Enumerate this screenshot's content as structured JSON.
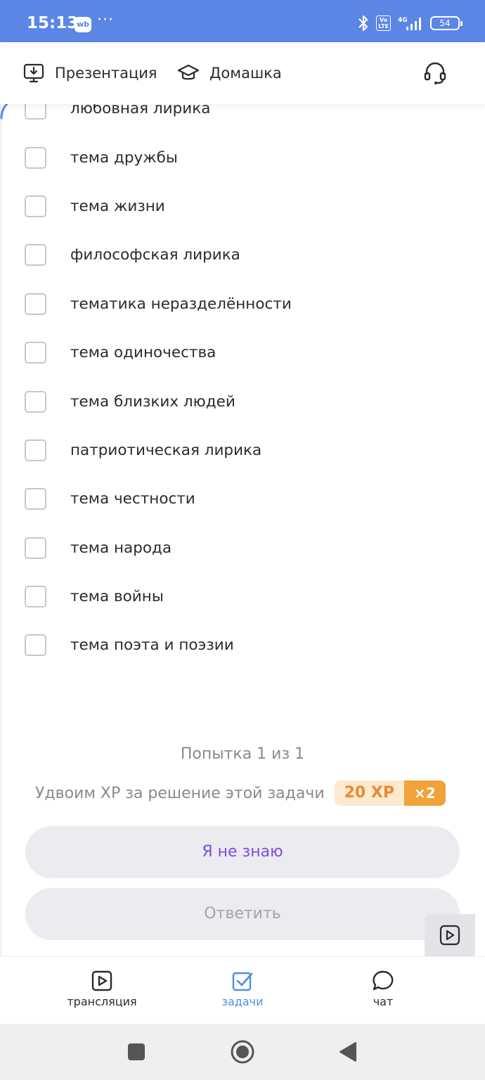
{
  "status_bar": {
    "time": "15:13",
    "app_badge": "wb",
    "more_dots": "···",
    "volte": "Vo\nLTE",
    "network": "4G",
    "battery": "54"
  },
  "top_nav": {
    "presentation_label": "Презентация",
    "homework_label": "Домашка"
  },
  "options": [
    "любовная лирика",
    "тема дружбы",
    "тема жизни",
    "философская лирика",
    "тематика неразделённости",
    "тема одиночества",
    "тема близких людей",
    "патриотическая лирика",
    "тема честности",
    "тема народа",
    "тема войны",
    "тема поэта и поэзии"
  ],
  "attempt_text": "Попытка 1 из 1",
  "xp": {
    "text": "Удвоим XP за решение этой задачи",
    "value": "20 XP",
    "multiplier": "×2"
  },
  "buttons": {
    "dont_know": "Я не знаю",
    "answer": "Ответить"
  },
  "bottom_tabs": {
    "stream": "трансляция",
    "tasks": "задачи",
    "chat": "чат"
  },
  "colors": {
    "status_bar": "#5b86e5",
    "accent_purple": "#7e4bdb",
    "active_tab": "#4a90e2",
    "xp_orange": "#f1a23a"
  }
}
